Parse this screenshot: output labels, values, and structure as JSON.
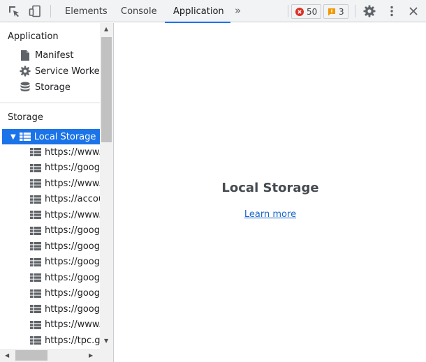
{
  "toolbar": {
    "tabs": [
      "Elements",
      "Console",
      "Application"
    ],
    "more_tabs": "»",
    "errors_count": "50",
    "warnings_count": "3",
    "error_color": "#d93025",
    "warning_color": "#f29900"
  },
  "sidebar": {
    "application_title": "Application",
    "application_items": [
      "Manifest",
      "Service Workers",
      "Storage"
    ],
    "storage_title": "Storage",
    "local_storage_label": "Local Storage",
    "origins": [
      "https://www.z",
      "https://googl",
      "https://www.y",
      "https://accou",
      "https://www.f",
      "https://googl",
      "https://googl",
      "https://googl",
      "https://googl",
      "https://googl",
      "https://googl",
      "https://www.y",
      "https://tpc.gc"
    ]
  },
  "main": {
    "title": "Local Storage",
    "learn_more": "Learn more"
  },
  "colors": {
    "accent": "#1a73e8",
    "toolbar_bg": "#f1f3f4"
  }
}
